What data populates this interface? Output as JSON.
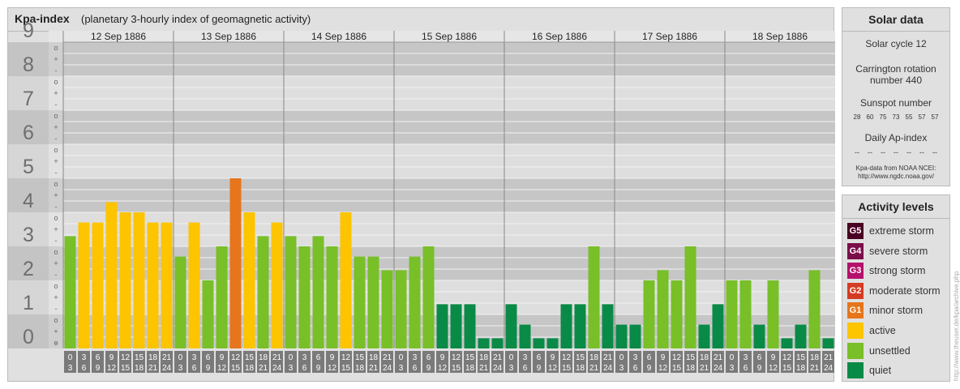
{
  "header": {
    "title": "Kpa-index",
    "subtitle": "(planetary 3-hourly index of geomagnetic activity)"
  },
  "chart_data": {
    "type": "bar",
    "ylim": [
      0,
      9
    ],
    "y_ticks": [
      "0",
      "1",
      "2",
      "3",
      "4",
      "5",
      "6",
      "7",
      "8",
      "9"
    ],
    "minor_ticks": [
      "o",
      "+",
      "-"
    ],
    "days": [
      {
        "label": "12 Sep 1886",
        "values": [
          3.3,
          3.7,
          3.7,
          4.3,
          4.0,
          4.0,
          3.7,
          3.7
        ]
      },
      {
        "label": "13 Sep 1886",
        "values": [
          2.7,
          3.7,
          2.0,
          3.0,
          5.0,
          4.0,
          3.3,
          3.7
        ]
      },
      {
        "label": "14 Sep 1886",
        "values": [
          3.3,
          3.0,
          3.3,
          3.0,
          4.0,
          2.7,
          2.7,
          2.3
        ]
      },
      {
        "label": "15 Sep 1886",
        "values": [
          2.3,
          2.7,
          3.0,
          1.3,
          1.3,
          1.3,
          0.3,
          0.3
        ]
      },
      {
        "label": "16 Sep 1886",
        "values": [
          1.3,
          0.7,
          0.3,
          0.3,
          1.3,
          1.3,
          3.0,
          1.3
        ]
      },
      {
        "label": "17 Sep 1886",
        "values": [
          0.7,
          0.7,
          2.0,
          2.3,
          2.0,
          3.0,
          0.7,
          1.3
        ]
      },
      {
        "label": "18 Sep 1886",
        "values": [
          2.0,
          2.0,
          0.7,
          2.0,
          0.3,
          0.7,
          2.3,
          0.3
        ]
      }
    ],
    "hour_ranges": [
      [
        "0",
        "3"
      ],
      [
        "3",
        "6"
      ],
      [
        "6",
        "9"
      ],
      [
        "9",
        "12"
      ],
      [
        "12",
        "15"
      ],
      [
        "15",
        "18"
      ],
      [
        "18",
        "21"
      ],
      [
        "21",
        "24"
      ]
    ],
    "colors": {
      "quiet": "#0a8a47",
      "unsettled": "#78bf28",
      "active": "#fdc400",
      "minor": "#e6751b",
      "moderate": "#d53b23",
      "strong": "#b5106c",
      "severe": "#7a0e4a",
      "extreme": "#4a0022"
    }
  },
  "solar": {
    "title": "Solar data",
    "cycle": "Solar cycle 12",
    "carrington_line1": "Carrington rotation",
    "carrington_line2": "number 440",
    "sunspot_title": "Sunspot number",
    "sunspots": [
      "28",
      "60",
      "75",
      "73",
      "55",
      "57",
      "57"
    ],
    "ap_title": "Daily Ap-index",
    "ap_values": [
      "--",
      "--",
      "--",
      "--",
      "--",
      "--",
      "--"
    ],
    "credit1": "Kpa-data from NOAA NCEI:",
    "credit2": "http://www.ngdc.noaa.gov/"
  },
  "levels": {
    "title": "Activity levels",
    "items": [
      {
        "code": "G5",
        "label": "extreme storm",
        "color": "#4a0022"
      },
      {
        "code": "G4",
        "label": "severe storm",
        "color": "#7a0e4a"
      },
      {
        "code": "G3",
        "label": "strong storm",
        "color": "#b5106c"
      },
      {
        "code": "G2",
        "label": "moderate storm",
        "color": "#d53b23"
      },
      {
        "code": "G1",
        "label": "minor storm",
        "color": "#e6751b"
      },
      {
        "code": "",
        "label": "active",
        "color": "#fdc400"
      },
      {
        "code": "",
        "label": "unsettled",
        "color": "#78bf28"
      },
      {
        "code": "",
        "label": "quiet",
        "color": "#0a8a47"
      }
    ]
  },
  "credit_vertical": "http://www.theuser.de/kpa/archive.php"
}
